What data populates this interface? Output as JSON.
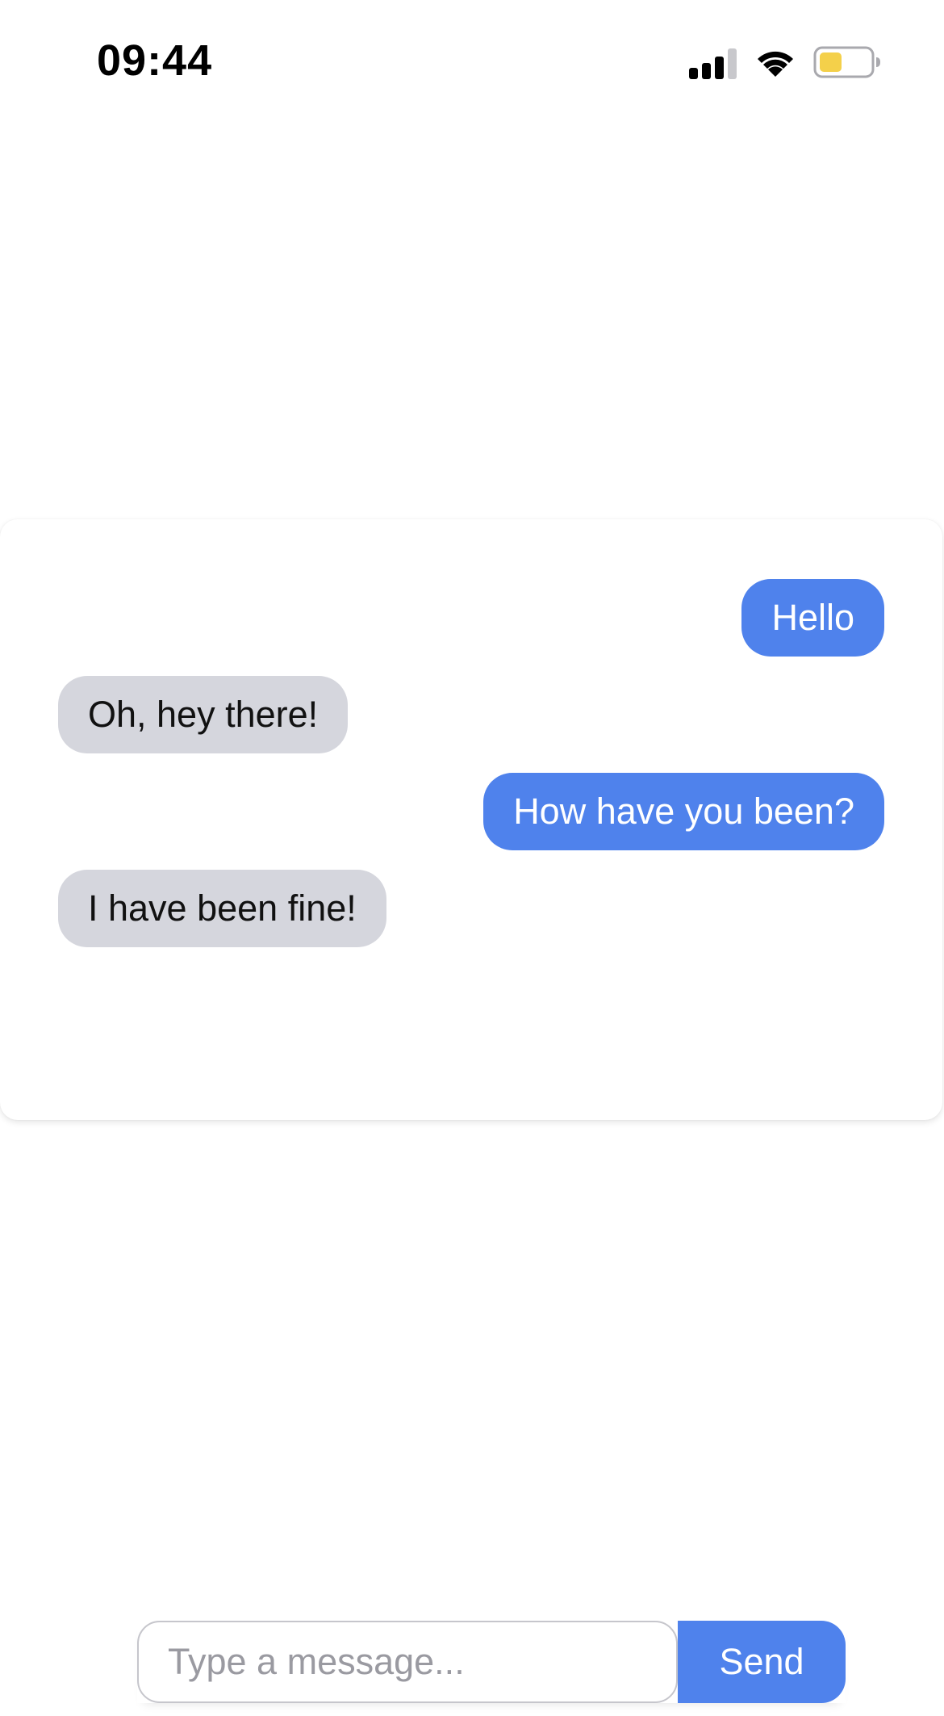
{
  "status_bar": {
    "time": "09:44",
    "icons": {
      "signal": "cellular-signal-icon",
      "wifi": "wifi-icon",
      "battery": "battery-icon"
    },
    "battery_level": 0.45,
    "signal_bars_active": 3,
    "signal_bars_total": 4
  },
  "chat": {
    "messages": [
      {
        "sender": "me",
        "text": "Hello"
      },
      {
        "sender": "other",
        "text": "Oh, hey there!"
      },
      {
        "sender": "me",
        "text": "How have you been?"
      },
      {
        "sender": "other",
        "text": "I have been fine!"
      }
    ]
  },
  "composer": {
    "input_value": "",
    "placeholder": "Type a message...",
    "send_label": "Send"
  },
  "colors": {
    "sent_bubble": "#4f82ec",
    "sent_text": "#ffffff",
    "received_bubble": "#d5d6dd",
    "received_text": "#111111",
    "send_button": "#4f82ec",
    "send_button_text": "#ffffff",
    "battery_fill": "#f4d04a",
    "battery_outline": "#a9a9ae",
    "signal_active": "#000000",
    "signal_inactive": "#c8c8cc"
  }
}
